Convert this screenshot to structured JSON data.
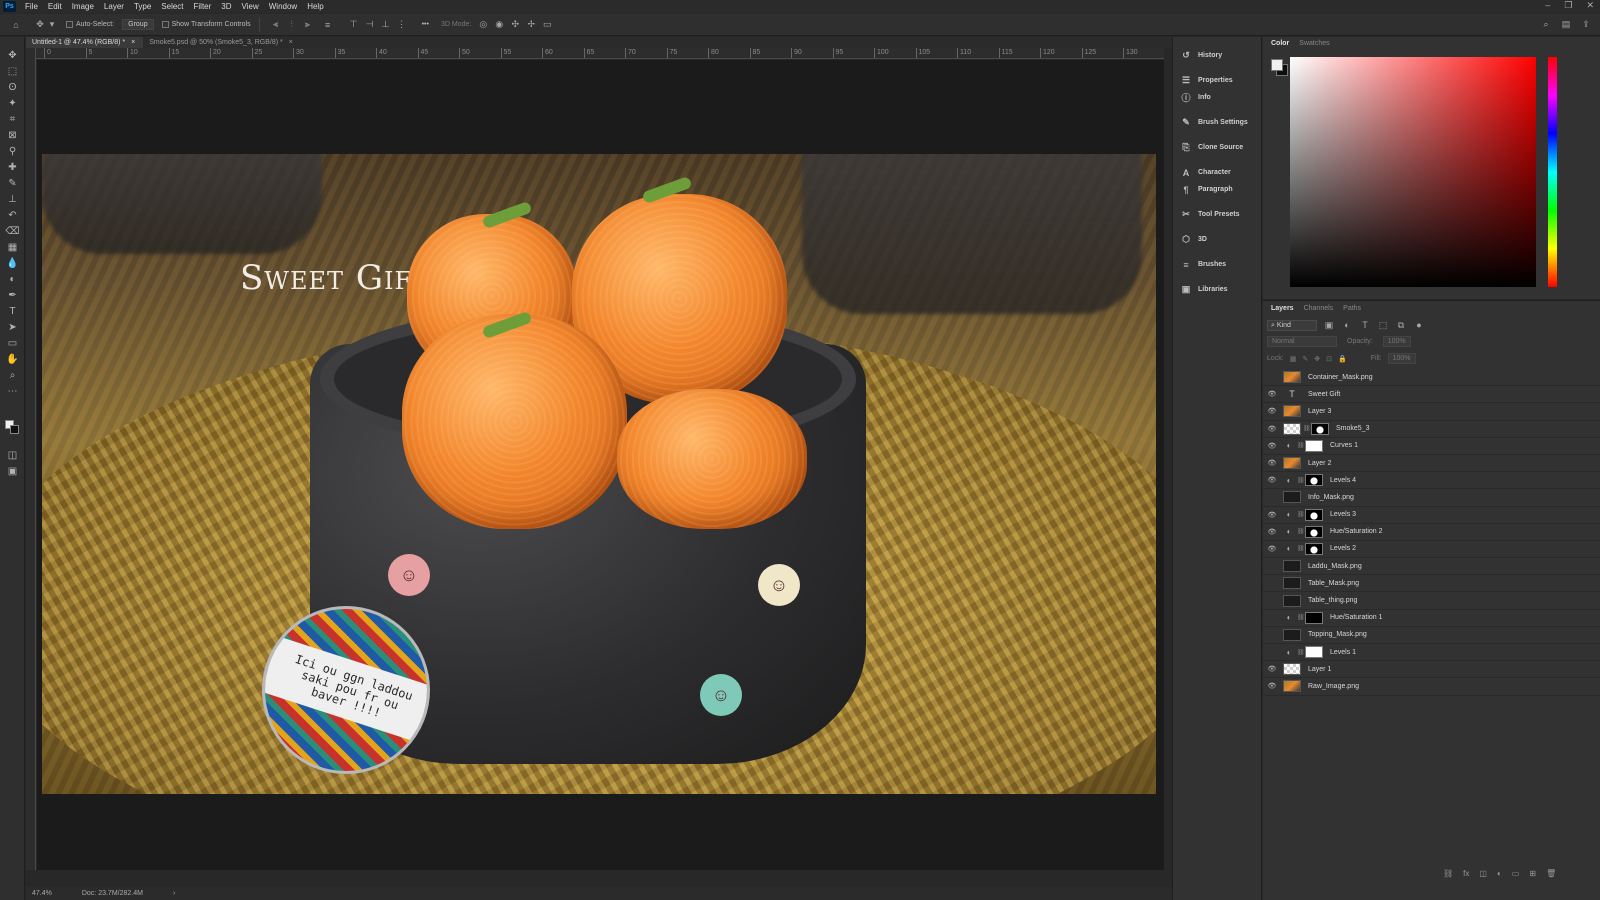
{
  "app": {
    "logo": "Ps"
  },
  "menu": [
    "File",
    "Edit",
    "Image",
    "Layer",
    "Type",
    "Select",
    "Filter",
    "3D",
    "View",
    "Window",
    "Help"
  ],
  "window_controls": [
    "–",
    "❐",
    "✕"
  ],
  "options": {
    "auto_select_label": "Auto-Select:",
    "auto_select_value": "Group",
    "transform_label": "Show Transform Controls",
    "mode_3d_label": "3D Mode:",
    "more_label": "•••"
  },
  "tabs": [
    {
      "label": "Untitled-1 @ 47.4% (RGB/8) *",
      "close": "×"
    },
    {
      "label": "Smoke5.psd @ 50% (Smoke5_3, RGB/8) *",
      "close": "×"
    }
  ],
  "ruler_ticks": [
    "0",
    "5",
    "10",
    "15",
    "20",
    "25",
    "30",
    "35",
    "40",
    "45",
    "50",
    "55",
    "60",
    "65",
    "70",
    "75",
    "80",
    "85",
    "90",
    "95",
    "100",
    "105",
    "110",
    "115",
    "120",
    "125",
    "130",
    "13"
  ],
  "document": {
    "caption": "Sweet Gift",
    "badge_text": "Ici ou ggn laddou\nsaki pou fr ou\nbaver !!!!"
  },
  "status": {
    "zoom": "47.4%",
    "doc_size": "Doc: 23.7M/282.4M",
    "arrow": "›"
  },
  "panel_icons": [
    {
      "icon": "history-icon",
      "glyph": "↺",
      "label": "History"
    },
    {
      "icon": "properties-icon",
      "glyph": "☰",
      "label": "Properties"
    },
    {
      "icon": "info-icon",
      "glyph": "ⓘ",
      "label": "Info"
    },
    {
      "icon": "brush-settings-icon",
      "glyph": "✎",
      "label": "Brush Settings"
    },
    {
      "icon": "clone-source-icon",
      "glyph": "⎘",
      "label": "Clone Source"
    },
    {
      "icon": "character-icon",
      "glyph": "A",
      "label": "Character"
    },
    {
      "icon": "paragraph-icon",
      "glyph": "¶",
      "label": "Paragraph"
    },
    {
      "icon": "tool-presets-icon",
      "glyph": "✂",
      "label": "Tool Presets"
    },
    {
      "icon": "3d-icon",
      "glyph": "⬡",
      "label": "3D"
    },
    {
      "icon": "brushes-icon",
      "glyph": "≡",
      "label": "Brushes"
    },
    {
      "icon": "libraries-icon",
      "glyph": "▣",
      "label": "Libraries"
    }
  ],
  "color_panel": {
    "tabs": [
      "Color",
      "Swatches"
    ]
  },
  "layers_panel": {
    "tabs": [
      "Layers",
      "Channels",
      "Paths"
    ],
    "kind": "Kind",
    "blend_mode": "Normal",
    "opacity_label": "Opacity:",
    "opacity_value": "100%",
    "lock_label": "Lock:",
    "fill_label": "Fill:",
    "fill_value": "100%",
    "layers": [
      {
        "name": "Container_Mask.png",
        "visible": false,
        "kind": "image"
      },
      {
        "name": "Sweet Gift",
        "visible": true,
        "kind": "type"
      },
      {
        "name": "Layer 3",
        "visible": true,
        "kind": "image"
      },
      {
        "name": "Smoke5_3",
        "visible": true,
        "kind": "smoke"
      },
      {
        "name": "Curves 1",
        "visible": true,
        "kind": "adj-white"
      },
      {
        "name": "Layer 2",
        "visible": true,
        "kind": "image"
      },
      {
        "name": "Levels 4",
        "visible": true,
        "kind": "adj-shape"
      },
      {
        "name": "Info_Mask.png",
        "visible": false,
        "kind": "dark"
      },
      {
        "name": "Levels 3",
        "visible": true,
        "kind": "adj-shape"
      },
      {
        "name": "Hue/Saturation 2",
        "visible": true,
        "kind": "adj-shape"
      },
      {
        "name": "Levels 2",
        "visible": true,
        "kind": "adj-shape"
      },
      {
        "name": "Laddu_Mask.png",
        "visible": false,
        "kind": "dark"
      },
      {
        "name": "Table_Mask.png",
        "visible": false,
        "kind": "dark"
      },
      {
        "name": "Table_thing.png",
        "visible": false,
        "kind": "dark"
      },
      {
        "name": "Hue/Saturation 1",
        "visible": false,
        "kind": "adj-black"
      },
      {
        "name": "Topping_Mask.png",
        "visible": false,
        "kind": "dark"
      },
      {
        "name": "Levels 1",
        "visible": false,
        "kind": "adj-white"
      },
      {
        "name": "Layer 1",
        "visible": true,
        "kind": "check"
      },
      {
        "name": "Raw_Image.png",
        "visible": true,
        "kind": "image"
      }
    ]
  }
}
